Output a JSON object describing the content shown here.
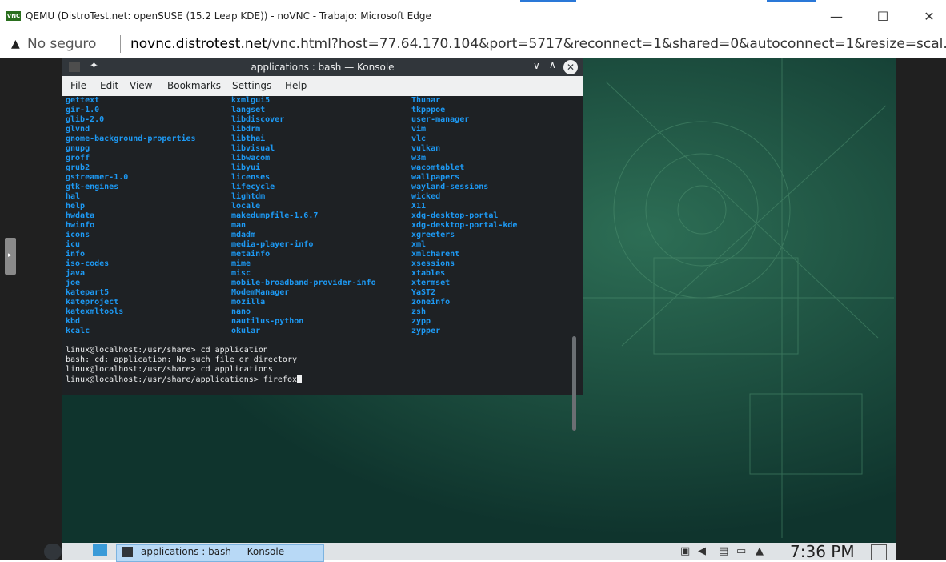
{
  "browser": {
    "window_title": "QEMU (DistroTest.net: openSUSE (15.2 Leap KDE)) - noVNC - Trabajo: Microsoft Edge",
    "security_label": "No seguro",
    "url_host": "novnc.distrotest.net",
    "url_path": "/vnc.html?host=77.64.170.104&port=5717&reconnect=1&shared=0&autoconnect=1&resize=scal...",
    "logo_text": "VNC"
  },
  "konsole": {
    "title": "applications : bash — Konsole",
    "menu": [
      "File",
      "Edit",
      "View",
      "Bookmarks",
      "Settings",
      "Help"
    ],
    "col1": [
      "gettext",
      "gir-1.0",
      "glib-2.0",
      "glvnd",
      "gnome-background-properties",
      "gnupg",
      "groff",
      "grub2",
      "gstreamer-1.0",
      "gtk-engines",
      "hal",
      "help",
      "hwdata",
      "hwinfo",
      "icons",
      "icu",
      "info",
      "iso-codes",
      "java",
      "joe",
      "katepart5",
      "kateproject",
      "katexmltools",
      "kbd",
      "kcalc"
    ],
    "col2": [
      "kxmlgui5",
      "langset",
      "libdiscover",
      "libdrm",
      "libthai",
      "libvisual",
      "libwacom",
      "libyui",
      "licenses",
      "lifecycle",
      "lightdm",
      "locale",
      "makedumpfile-1.6.7",
      "man",
      "mdadm",
      "media-player-info",
      "metainfo",
      "mime",
      "misc",
      "mobile-broadband-provider-info",
      "ModemManager",
      "mozilla",
      "nano",
      "nautilus-python",
      "okular"
    ],
    "col3": [
      "Thunar",
      "tkpppoe",
      "user-manager",
      "vim",
      "vlc",
      "vulkan",
      "w3m",
      "wacomtablet",
      "wallpapers",
      "wayland-sessions",
      "wicked",
      "X11",
      "xdg-desktop-portal",
      "xdg-desktop-portal-kde",
      "xgreeters",
      "xml",
      "xmlcharent",
      "xsessions",
      "xtables",
      "xtermset",
      "YaST2",
      "zoneinfo",
      "zsh",
      "zypp",
      "zypper"
    ],
    "lines": [
      "linux@localhost:/usr/share> cd application",
      "bash: cd: application: No such file or directory",
      "linux@localhost:/usr/share> cd applications",
      "linux@localhost:/usr/share/applications> firefox"
    ]
  },
  "taskbar": {
    "task_label": "applications : bash — Konsole",
    "clock": "7:36 PM"
  }
}
